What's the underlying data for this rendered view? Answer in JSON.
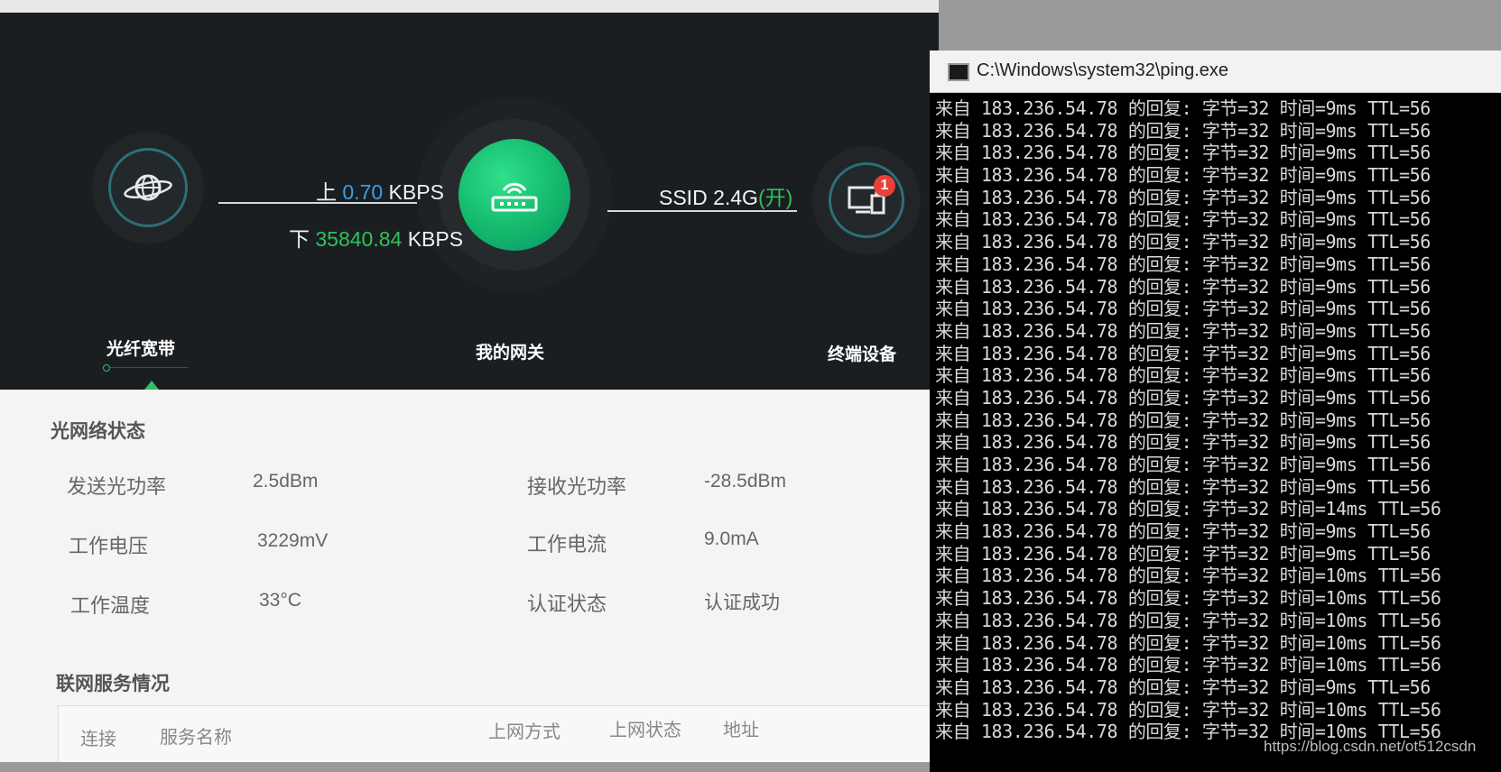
{
  "router": {
    "up_prefix": "上",
    "up_value": "0.70",
    "up_unit": "KBPS",
    "down_prefix": "下",
    "down_value": "35840.84",
    "down_unit": "KBPS",
    "ssid_label": "SSID 2.4G",
    "ssid_state": "(开)",
    "device_badge": "1",
    "nodes": {
      "fiber": "光纤宽带",
      "gateway": "我的网关",
      "devices": "终端设备"
    },
    "optical_section_title": "光网络状态",
    "optical": [
      {
        "label": "发送光功率",
        "value": "2.5dBm"
      },
      {
        "label": "接收光功率",
        "value": "-28.5dBm"
      },
      {
        "label": "工作电压",
        "value": "3229mV"
      },
      {
        "label": "工作电流",
        "value": "9.0mA"
      },
      {
        "label": "工作温度",
        "value": "33°C"
      },
      {
        "label": "认证状态",
        "value": "认证成功"
      }
    ],
    "service_section_title": "联网服务情况",
    "service_table_headers": [
      "连接",
      "服务名称",
      "上网方式",
      "上网状态",
      "地址"
    ]
  },
  "cmd": {
    "title": "C:\\Windows\\system32\\ping.exe",
    "lines": [
      "来自 183.236.54.78 的回复: 字节=32 时间=9ms TTL=56",
      "来自 183.236.54.78 的回复: 字节=32 时间=9ms TTL=56",
      "来自 183.236.54.78 的回复: 字节=32 时间=9ms TTL=56",
      "来自 183.236.54.78 的回复: 字节=32 时间=9ms TTL=56",
      "来自 183.236.54.78 的回复: 字节=32 时间=9ms TTL=56",
      "来自 183.236.54.78 的回复: 字节=32 时间=9ms TTL=56",
      "来自 183.236.54.78 的回复: 字节=32 时间=9ms TTL=56",
      "来自 183.236.54.78 的回复: 字节=32 时间=9ms TTL=56",
      "来自 183.236.54.78 的回复: 字节=32 时间=9ms TTL=56",
      "来自 183.236.54.78 的回复: 字节=32 时间=9ms TTL=56",
      "来自 183.236.54.78 的回复: 字节=32 时间=9ms TTL=56",
      "来自 183.236.54.78 的回复: 字节=32 时间=9ms TTL=56",
      "来自 183.236.54.78 的回复: 字节=32 时间=9ms TTL=56",
      "来自 183.236.54.78 的回复: 字节=32 时间=9ms TTL=56",
      "来自 183.236.54.78 的回复: 字节=32 时间=9ms TTL=56",
      "来自 183.236.54.78 的回复: 字节=32 时间=9ms TTL=56",
      "来自 183.236.54.78 的回复: 字节=32 时间=9ms TTL=56",
      "来自 183.236.54.78 的回复: 字节=32 时间=9ms TTL=56",
      "来自 183.236.54.78 的回复: 字节=32 时间=14ms TTL=56",
      "来自 183.236.54.78 的回复: 字节=32 时间=9ms TTL=56",
      "来自 183.236.54.78 的回复: 字节=32 时间=9ms TTL=56",
      "来自 183.236.54.78 的回复: 字节=32 时间=10ms TTL=56",
      "来自 183.236.54.78 的回复: 字节=32 时间=10ms TTL=56",
      "来自 183.236.54.78 的回复: 字节=32 时间=10ms TTL=56",
      "来自 183.236.54.78 的回复: 字节=32 时间=10ms TTL=56",
      "来自 183.236.54.78 的回复: 字节=32 时间=10ms TTL=56",
      "来自 183.236.54.78 的回复: 字节=32 时间=9ms TTL=56",
      "来自 183.236.54.78 的回复: 字节=32 时间=10ms TTL=56",
      "来自 183.236.54.78 的回复: 字节=32 时间=10ms TTL=56"
    ]
  },
  "watermark": "https://blog.csdn.net/ot512csdn"
}
